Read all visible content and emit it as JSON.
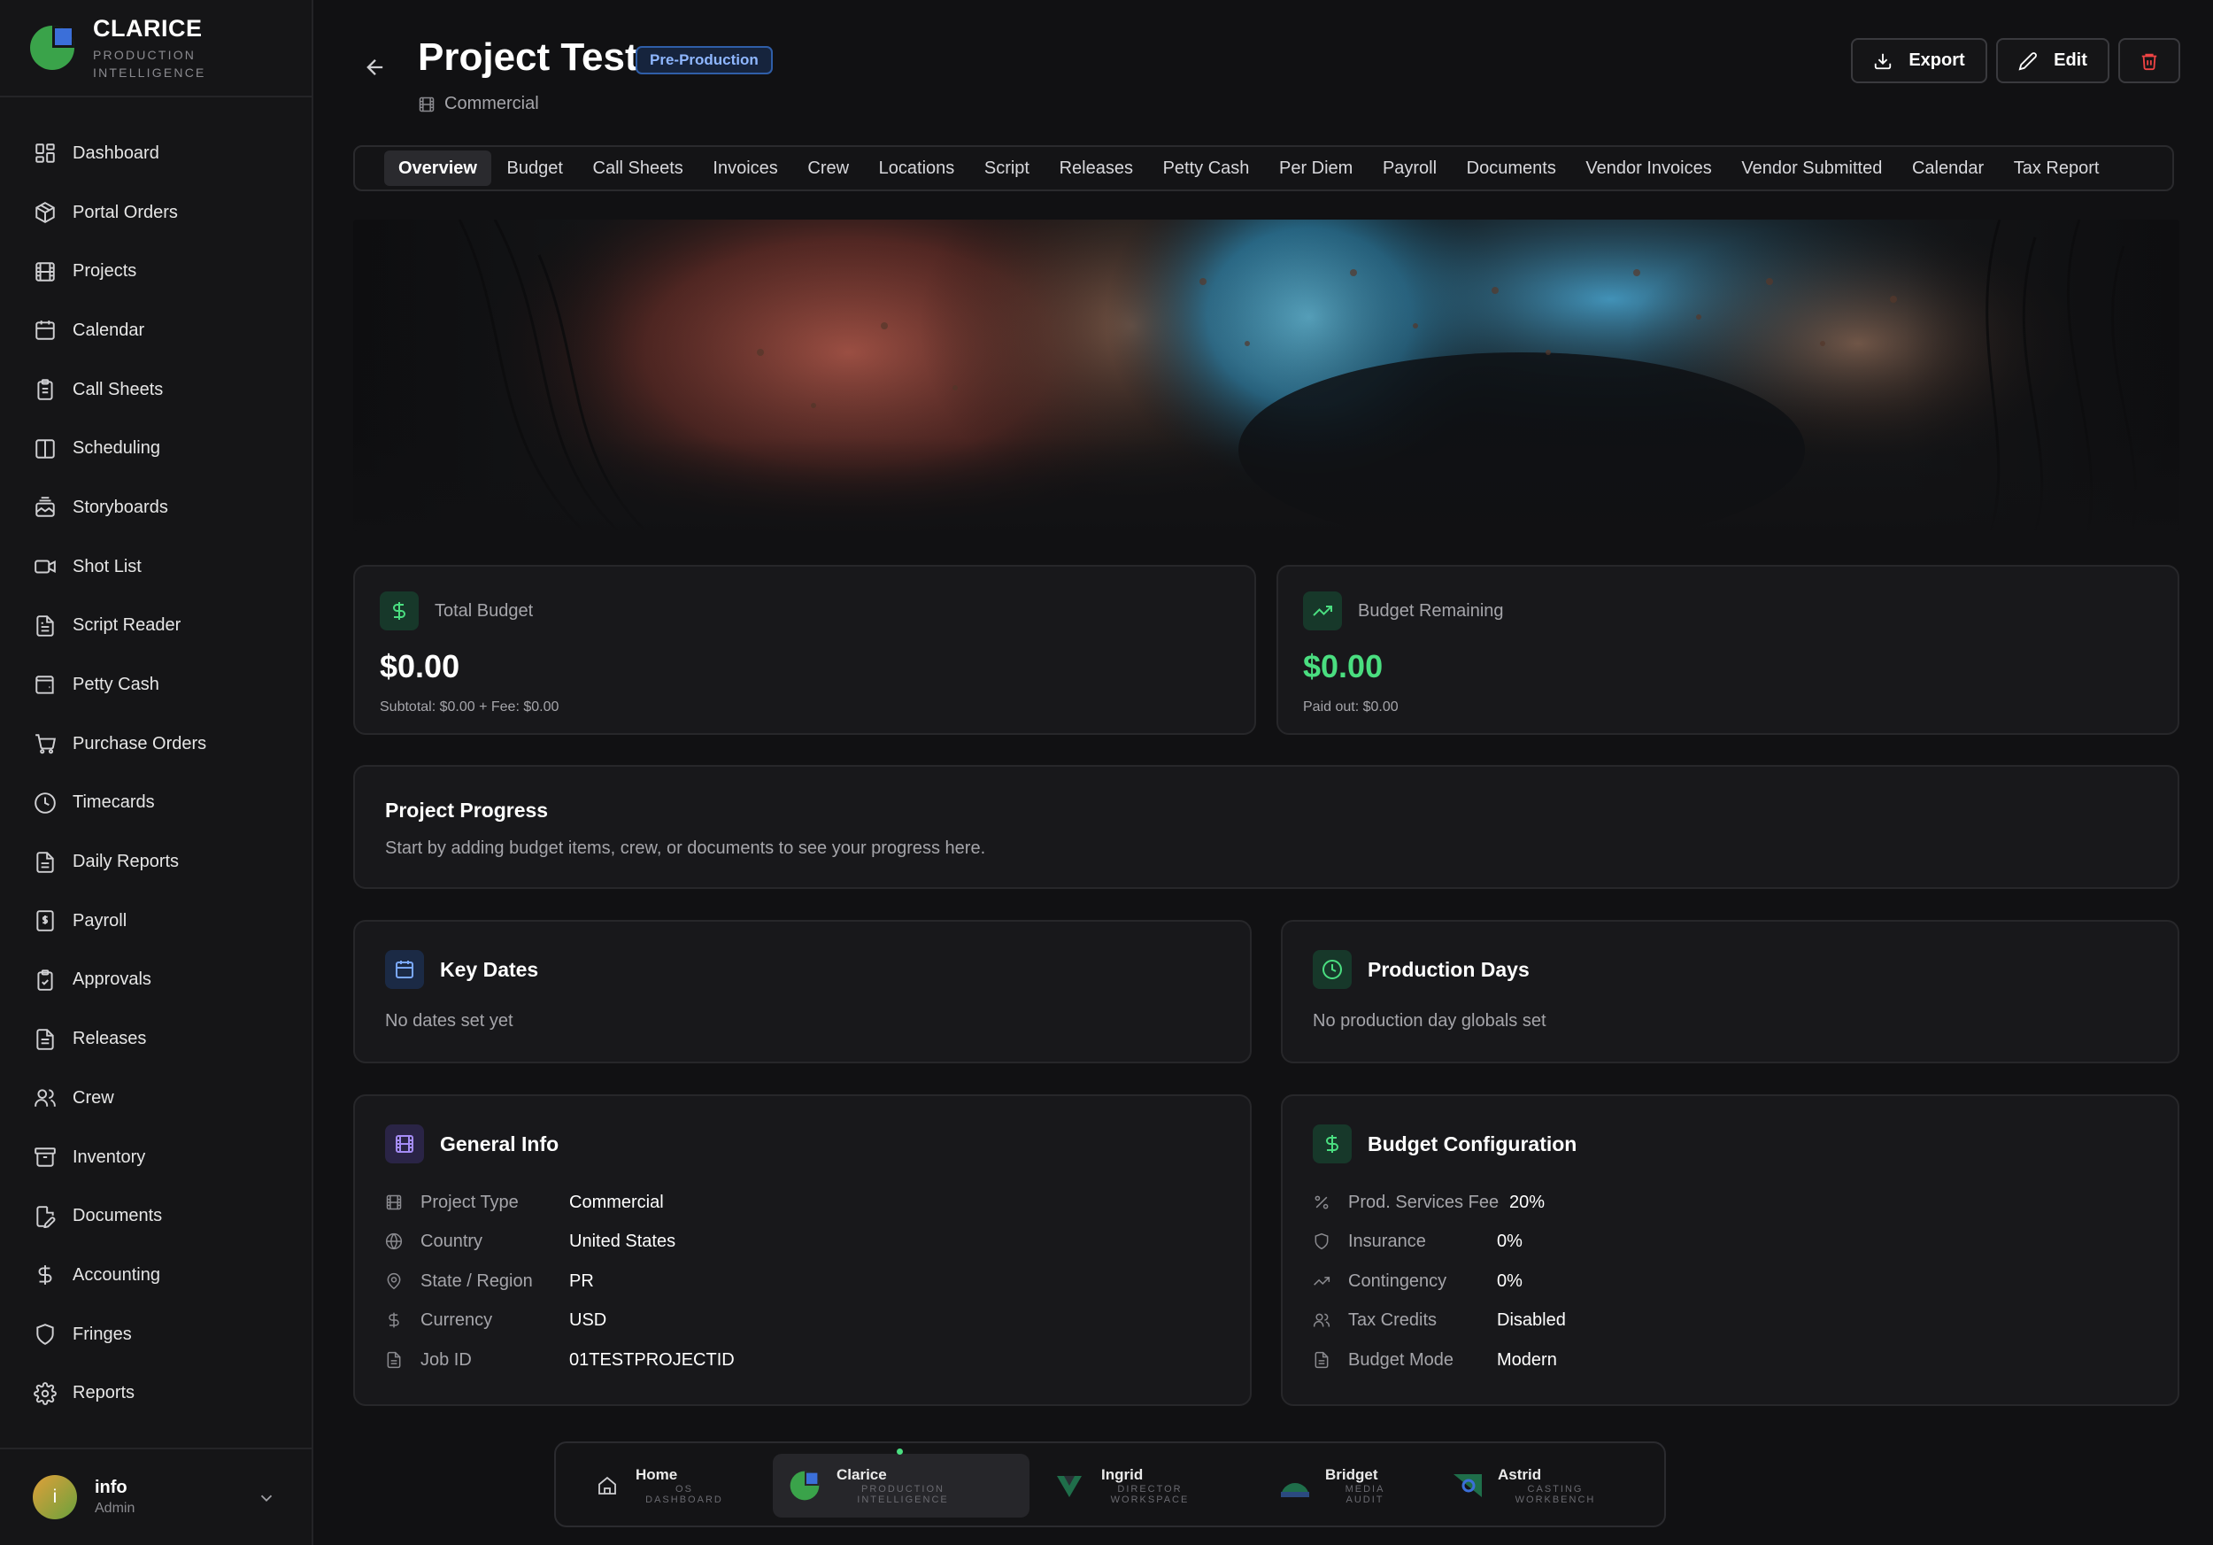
{
  "brand": {
    "name": "CLARICE",
    "subtitle": "PRODUCTION INTELLIGENCE"
  },
  "sidebar": {
    "items": [
      {
        "label": "Dashboard",
        "icon": "layout-dashboard-icon"
      },
      {
        "label": "Portal Orders",
        "icon": "package-icon"
      },
      {
        "label": "Projects",
        "icon": "film-icon"
      },
      {
        "label": "Calendar",
        "icon": "calendar-icon"
      },
      {
        "label": "Call Sheets",
        "icon": "clipboard-icon"
      },
      {
        "label": "Scheduling",
        "icon": "columns-icon"
      },
      {
        "label": "Storyboards",
        "icon": "images-icon"
      },
      {
        "label": "Shot List",
        "icon": "video-icon"
      },
      {
        "label": "Script Reader",
        "icon": "file-text-icon"
      },
      {
        "label": "Petty Cash",
        "icon": "wallet-icon"
      },
      {
        "label": "Purchase Orders",
        "icon": "cart-icon"
      },
      {
        "label": "Timecards",
        "icon": "clock-icon"
      },
      {
        "label": "Daily Reports",
        "icon": "file-text-icon"
      },
      {
        "label": "Payroll",
        "icon": "receipt-icon"
      },
      {
        "label": "Approvals",
        "icon": "clipboard-check-icon"
      },
      {
        "label": "Releases",
        "icon": "file-icon"
      },
      {
        "label": "Crew",
        "icon": "users-icon"
      },
      {
        "label": "Inventory",
        "icon": "archive-icon"
      },
      {
        "label": "Documents",
        "icon": "file-edit-icon"
      },
      {
        "label": "Accounting",
        "icon": "dollar-icon"
      },
      {
        "label": "Fringes",
        "icon": "shield-icon"
      },
      {
        "label": "Reports",
        "icon": "gear-icon"
      }
    ]
  },
  "user": {
    "initial": "i",
    "name": "info",
    "role": "Admin"
  },
  "header": {
    "title": "Project Test",
    "status_badge": "Pre-Production",
    "subtitle": "Commercial",
    "export_label": "Export",
    "edit_label": "Edit"
  },
  "tabs": [
    "Overview",
    "Budget",
    "Call Sheets",
    "Invoices",
    "Crew",
    "Locations",
    "Script",
    "Releases",
    "Petty Cash",
    "Per Diem",
    "Payroll",
    "Documents",
    "Vendor Invoices",
    "Vendor Submitted",
    "Calendar",
    "Tax Report"
  ],
  "active_tab": "Overview",
  "stats": {
    "total_budget": {
      "label": "Total Budget",
      "value": "$0.00",
      "sub": "Subtotal: $0.00 + Fee: $0.00"
    },
    "budget_remaining": {
      "label": "Budget Remaining",
      "value": "$0.00",
      "sub": "Paid out: $0.00"
    }
  },
  "progress": {
    "title": "Project Progress",
    "text": "Start by adding budget items, crew, or documents to see your progress here."
  },
  "key_dates": {
    "title": "Key Dates",
    "text": "No dates set yet"
  },
  "production_days": {
    "title": "Production Days",
    "text": "No production day globals set"
  },
  "general_info": {
    "title": "General Info",
    "rows": [
      {
        "label": "Project Type",
        "value": "Commercial",
        "icon": "film-icon"
      },
      {
        "label": "Country",
        "value": "United States",
        "icon": "globe-icon"
      },
      {
        "label": "State / Region",
        "value": "PR",
        "icon": "map-pin-icon"
      },
      {
        "label": "Currency",
        "value": "USD",
        "icon": "dollar-icon"
      },
      {
        "label": "Job ID",
        "value": "01TESTPROJECTID",
        "icon": "file-icon"
      }
    ]
  },
  "budget_config": {
    "title": "Budget Configuration",
    "rows": [
      {
        "label": "Prod. Services Fee",
        "value": "20%",
        "icon": "percent-icon"
      },
      {
        "label": "Insurance",
        "value": "0%",
        "icon": "shield-icon"
      },
      {
        "label": "Contingency",
        "value": "0%",
        "icon": "trending-up-icon"
      },
      {
        "label": "Tax Credits",
        "value": "Disabled",
        "icon": "users-icon"
      },
      {
        "label": "Budget Mode",
        "value": "Modern",
        "icon": "file-icon"
      }
    ]
  },
  "dock": [
    {
      "name": "Home",
      "sub": "OS DASHBOARD"
    },
    {
      "name": "Clarice",
      "sub": "PRODUCTION INTELLIGENCE"
    },
    {
      "name": "Ingrid",
      "sub": "DIRECTOR WORKSPACE"
    },
    {
      "name": "Bridget",
      "sub": "MEDIA AUDIT"
    },
    {
      "name": "Astrid",
      "sub": "CASTING WORKBENCH"
    }
  ],
  "colors": {
    "accent_green": "#4ade80",
    "badge_blue": "#8fb7ff",
    "danger": "#ef4444",
    "background": "#111113"
  }
}
